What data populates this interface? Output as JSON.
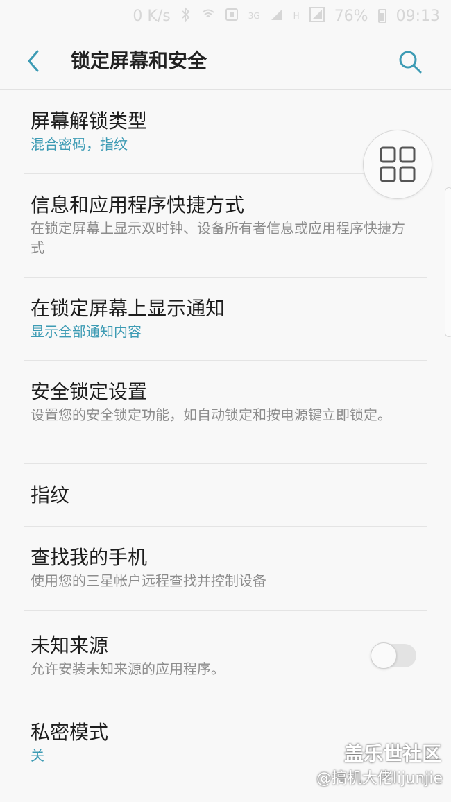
{
  "status_bar": {
    "speed": "0 K/s",
    "network": "3G",
    "h_indicator": "H",
    "battery": "76%",
    "time": "09:13"
  },
  "header": {
    "title": "锁定屏幕和安全"
  },
  "items": [
    {
      "title": "屏幕解锁类型",
      "subtitle": "混合密码，指纹"
    },
    {
      "title": "信息和应用程序快捷方式",
      "subtitle": "在锁定屏幕上显示双时钟、设备所有者信息或应用程序快捷方式"
    },
    {
      "title": "在锁定屏幕上显示通知",
      "subtitle": "显示全部通知内容"
    },
    {
      "title": "安全锁定设置",
      "subtitle": "设置您的安全锁定功能，如自动锁定和按电源键立即锁定。"
    },
    {
      "title": "指纹"
    },
    {
      "title": "查找我的手机",
      "subtitle": "使用您的三星帐户远程查找并控制设备"
    },
    {
      "title": "未知来源",
      "subtitle": "允许安装未知来源的应用程序。",
      "toggle_on": false
    },
    {
      "title": "私密模式",
      "subtitle": "关"
    }
  ],
  "watermark": {
    "line1": "盖乐世社区",
    "line2": "@搞机大佬lijunjie"
  },
  "colors": {
    "accent": "#3d9bb4",
    "background": "#f8f8f8"
  }
}
